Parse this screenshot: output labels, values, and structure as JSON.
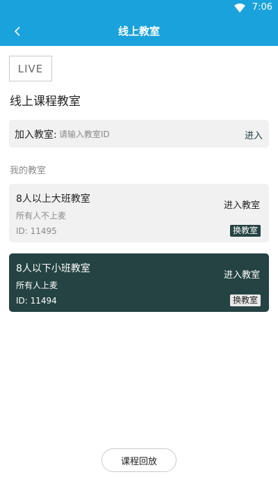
{
  "status_bar": {
    "time": "7:06",
    "wifi_icon": "wifi-icon"
  },
  "app_bar": {
    "back_icon": "chevron-left-icon",
    "title": "线上教室"
  },
  "logo": {
    "text": "LIVE"
  },
  "section_title": "线上课程教室",
  "join": {
    "label": "加入教室:",
    "placeholder": "请输入教室ID",
    "value": "",
    "enter_label": "进入"
  },
  "my_classrooms": {
    "label": "我的教室",
    "rooms": [
      {
        "name": "8人以上大班教室",
        "desc": "所有人不上麦",
        "id": "ID: 11495",
        "enter": "进入教室",
        "switch": "换教室"
      },
      {
        "name": "8人以下小班教室",
        "desc": "所有人上麦",
        "id": "ID: 11494",
        "enter": "进入教室",
        "switch": "换教室"
      }
    ]
  },
  "replay_button": "课程回放",
  "colors": {
    "primary": "#1aa2dc",
    "dark_card": "#244342",
    "light_card": "#f1f1f1"
  }
}
